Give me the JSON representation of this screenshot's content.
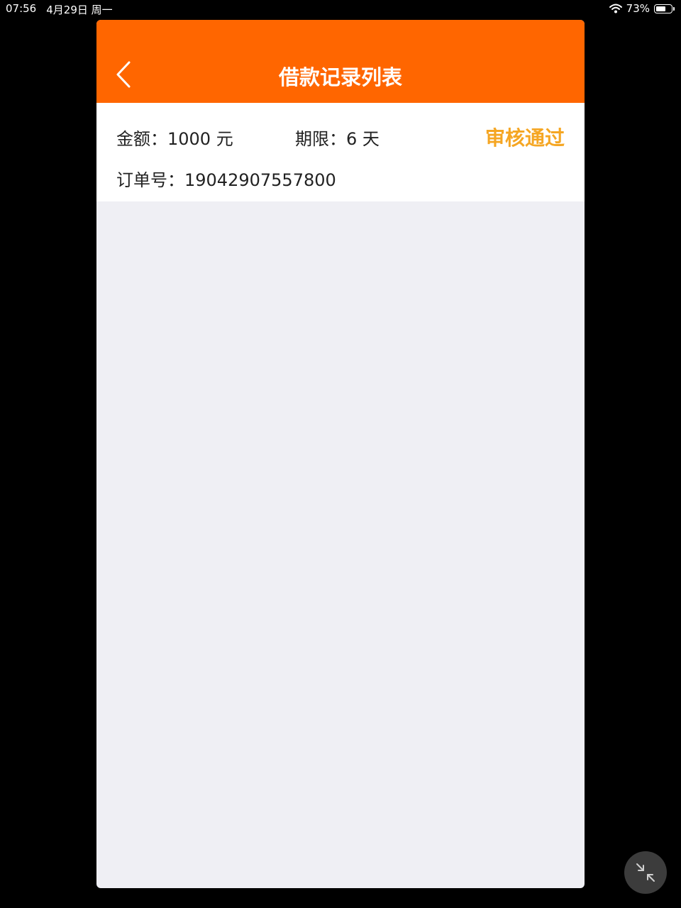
{
  "status_bar": {
    "time": "07:56",
    "date": "4月29日 周一",
    "battery": "73%",
    "battery_level": 0.73,
    "icons": [
      "wifi-icon",
      "battery-icon"
    ]
  },
  "nav": {
    "title": "借款记录列表",
    "back_icon": "chevron-left-icon",
    "background_color": "#ff6600"
  },
  "records": [
    {
      "amount_label": "金额：",
      "amount_value": "1000 元",
      "term_label": "期限：",
      "term_value": "6 天",
      "status": "审核通过",
      "status_color": "#f5a623",
      "order_label": "订单号：",
      "order_value": "19042907557800"
    }
  ],
  "floating_button": {
    "icon": "collapse-arrows-icon"
  }
}
